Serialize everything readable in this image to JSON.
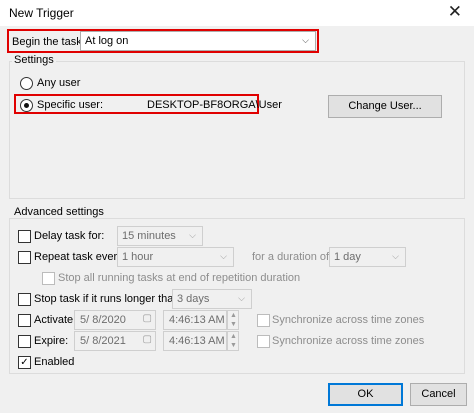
{
  "window": {
    "title": "New Trigger",
    "close_glyph": "✕"
  },
  "begin": {
    "label": "Begin the task:",
    "value": "At log on"
  },
  "settings": {
    "legend": "Settings",
    "any_user_label": "Any user",
    "specific_user_label": "Specific user:",
    "specific_user_value": "DESKTOP-BF8ORGA\\User",
    "change_user_button": "Change User..."
  },
  "advanced": {
    "legend": "Advanced settings",
    "delay_label": "Delay task for:",
    "delay_value": "15 minutes",
    "repeat_label": "Repeat task every:",
    "repeat_value": "1 hour",
    "duration_label": "for a duration of:",
    "duration_value": "1 day",
    "stop_running_label": "Stop all running tasks at end of repetition duration",
    "stop_longer_label": "Stop task if it runs longer than:",
    "stop_longer_value": "3 days",
    "activate_label": "Activate:",
    "activate_date": "5/ 8/2020",
    "activate_time": "4:46:13 AM",
    "expire_label": "Expire:",
    "expire_date": "5/ 8/2021",
    "expire_time": "4:46:13 AM",
    "sync_label": "Synchronize across time zones",
    "enabled_label": "Enabled",
    "enabled_check": "✓"
  },
  "footer": {
    "ok": "OK",
    "cancel": "Cancel"
  },
  "colors": {
    "highlight": "#e00000",
    "accent": "#0078d7"
  }
}
